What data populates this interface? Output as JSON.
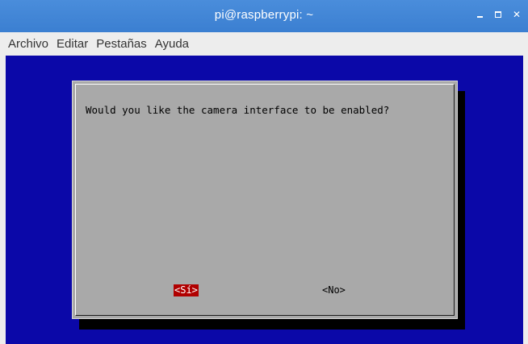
{
  "window": {
    "title": "pi@raspberrypi: ~",
    "controls": [
      "minimize-icon",
      "maximize-icon",
      "close-icon"
    ],
    "close_glyph": "✕"
  },
  "menubar": {
    "items": [
      "Archivo",
      "Editar",
      "Pestañas",
      "Ayuda"
    ]
  },
  "terminal": {
    "background_color": "#0b08a8"
  },
  "dialog": {
    "message": "Would you like the camera interface to be enabled?",
    "yes_label": "<Sí>",
    "no_label": "<No>",
    "selected_button": "yes",
    "selected_color": "#b00000"
  }
}
